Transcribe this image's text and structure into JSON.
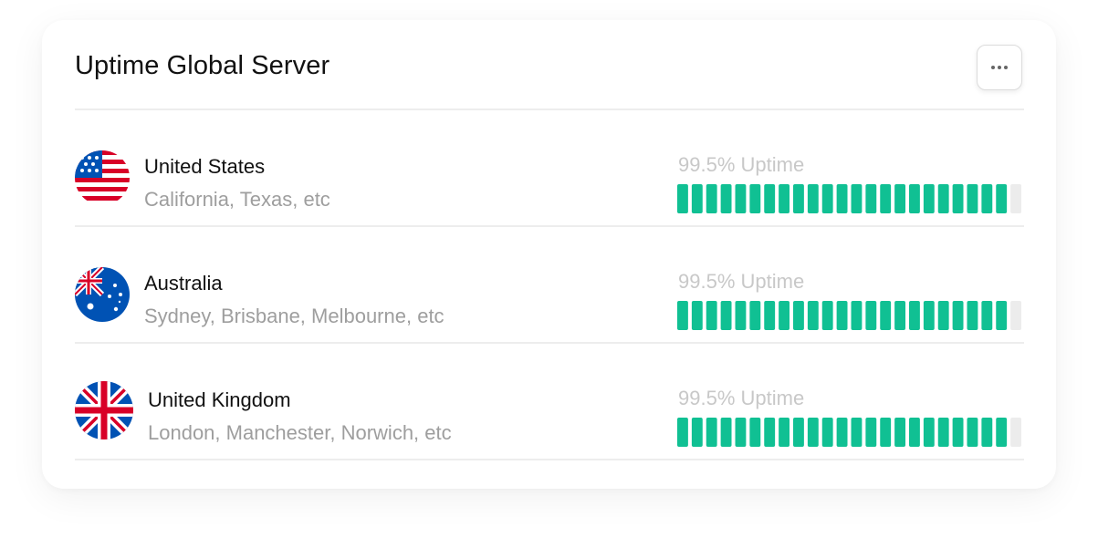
{
  "header": {
    "title": "Uptime Global Server"
  },
  "servers": [
    {
      "country": "United States",
      "regions": "California, Texas, etc",
      "uptime_label": "99.5% Uptime",
      "flag_icon": "us-flag-icon",
      "uptime_percent": 99.5
    },
    {
      "country": "Australia",
      "regions": "Sydney, Brisbane, Melbourne, etc",
      "uptime_label": "99.5% Uptime",
      "flag_icon": "australia-flag-icon",
      "uptime_percent": 99.5
    },
    {
      "country": "United Kingdom",
      "regions": "London, Manchester, Norwich, etc",
      "uptime_label": "99.5% Uptime",
      "flag_icon": "uk-flag-icon",
      "uptime_percent": 99.5
    }
  ],
  "bar_segments": {
    "total": 24,
    "active": 23
  },
  "colors": {
    "active": "#10c093",
    "inactive": "#ececec",
    "muted_text": "#9e9e9e"
  }
}
